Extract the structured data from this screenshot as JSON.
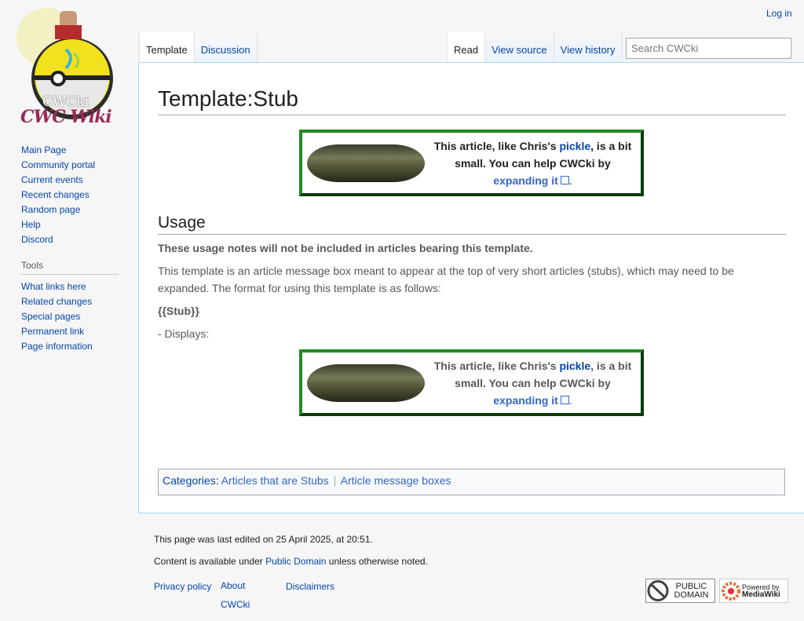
{
  "header": {
    "login": "Log in",
    "search_placeholder": "Search CWCki"
  },
  "logo": {
    "text": "CWCki"
  },
  "tabs": {
    "template": "Template",
    "discussion": "Discussion",
    "read": "Read",
    "view_source": "View source",
    "view_history": "View history"
  },
  "sidebar": {
    "nav": [
      "Main Page",
      "Community portal",
      "Current events",
      "Recent changes",
      "Random page",
      "Help",
      "Discord"
    ],
    "tools_heading": "Tools",
    "tools": [
      "What links here",
      "Related changes",
      "Special pages",
      "Permanent link",
      "Page information"
    ]
  },
  "page": {
    "title": "Template:Stub",
    "stub": {
      "text_before": "This article, like Chris's ",
      "pickle_link": "pickle",
      "text_middle": ", is a bit small. You can help CWCki by ",
      "expand_link": "expanding it",
      "text_after": "."
    },
    "usage_heading": "Usage",
    "usage_note": "These usage notes will not be included in articles bearing this template.",
    "usage_desc": "This template is an article message box meant to appear at the top of very short articles (stubs), which may need to be expanded. The format for using this template is as follows:",
    "code": "{{Stub}}",
    "displays": "- Displays:"
  },
  "categories": {
    "label": "Categories",
    "items": [
      "Articles that are Stubs",
      "Article message boxes"
    ]
  },
  "footer": {
    "last_edited": "This page was last edited on 25 April 2025, at 20:51.",
    "content_before": "Content is available under ",
    "license": "Public Domain",
    "content_after": " unless otherwise noted.",
    "links": [
      "Privacy policy",
      "About CWCki",
      "Disclaimers"
    ],
    "pd_badge": "PUBLIC DOMAIN",
    "mw_badge_top": "Powered by",
    "mw_badge_bottom": "MediaWiki"
  }
}
